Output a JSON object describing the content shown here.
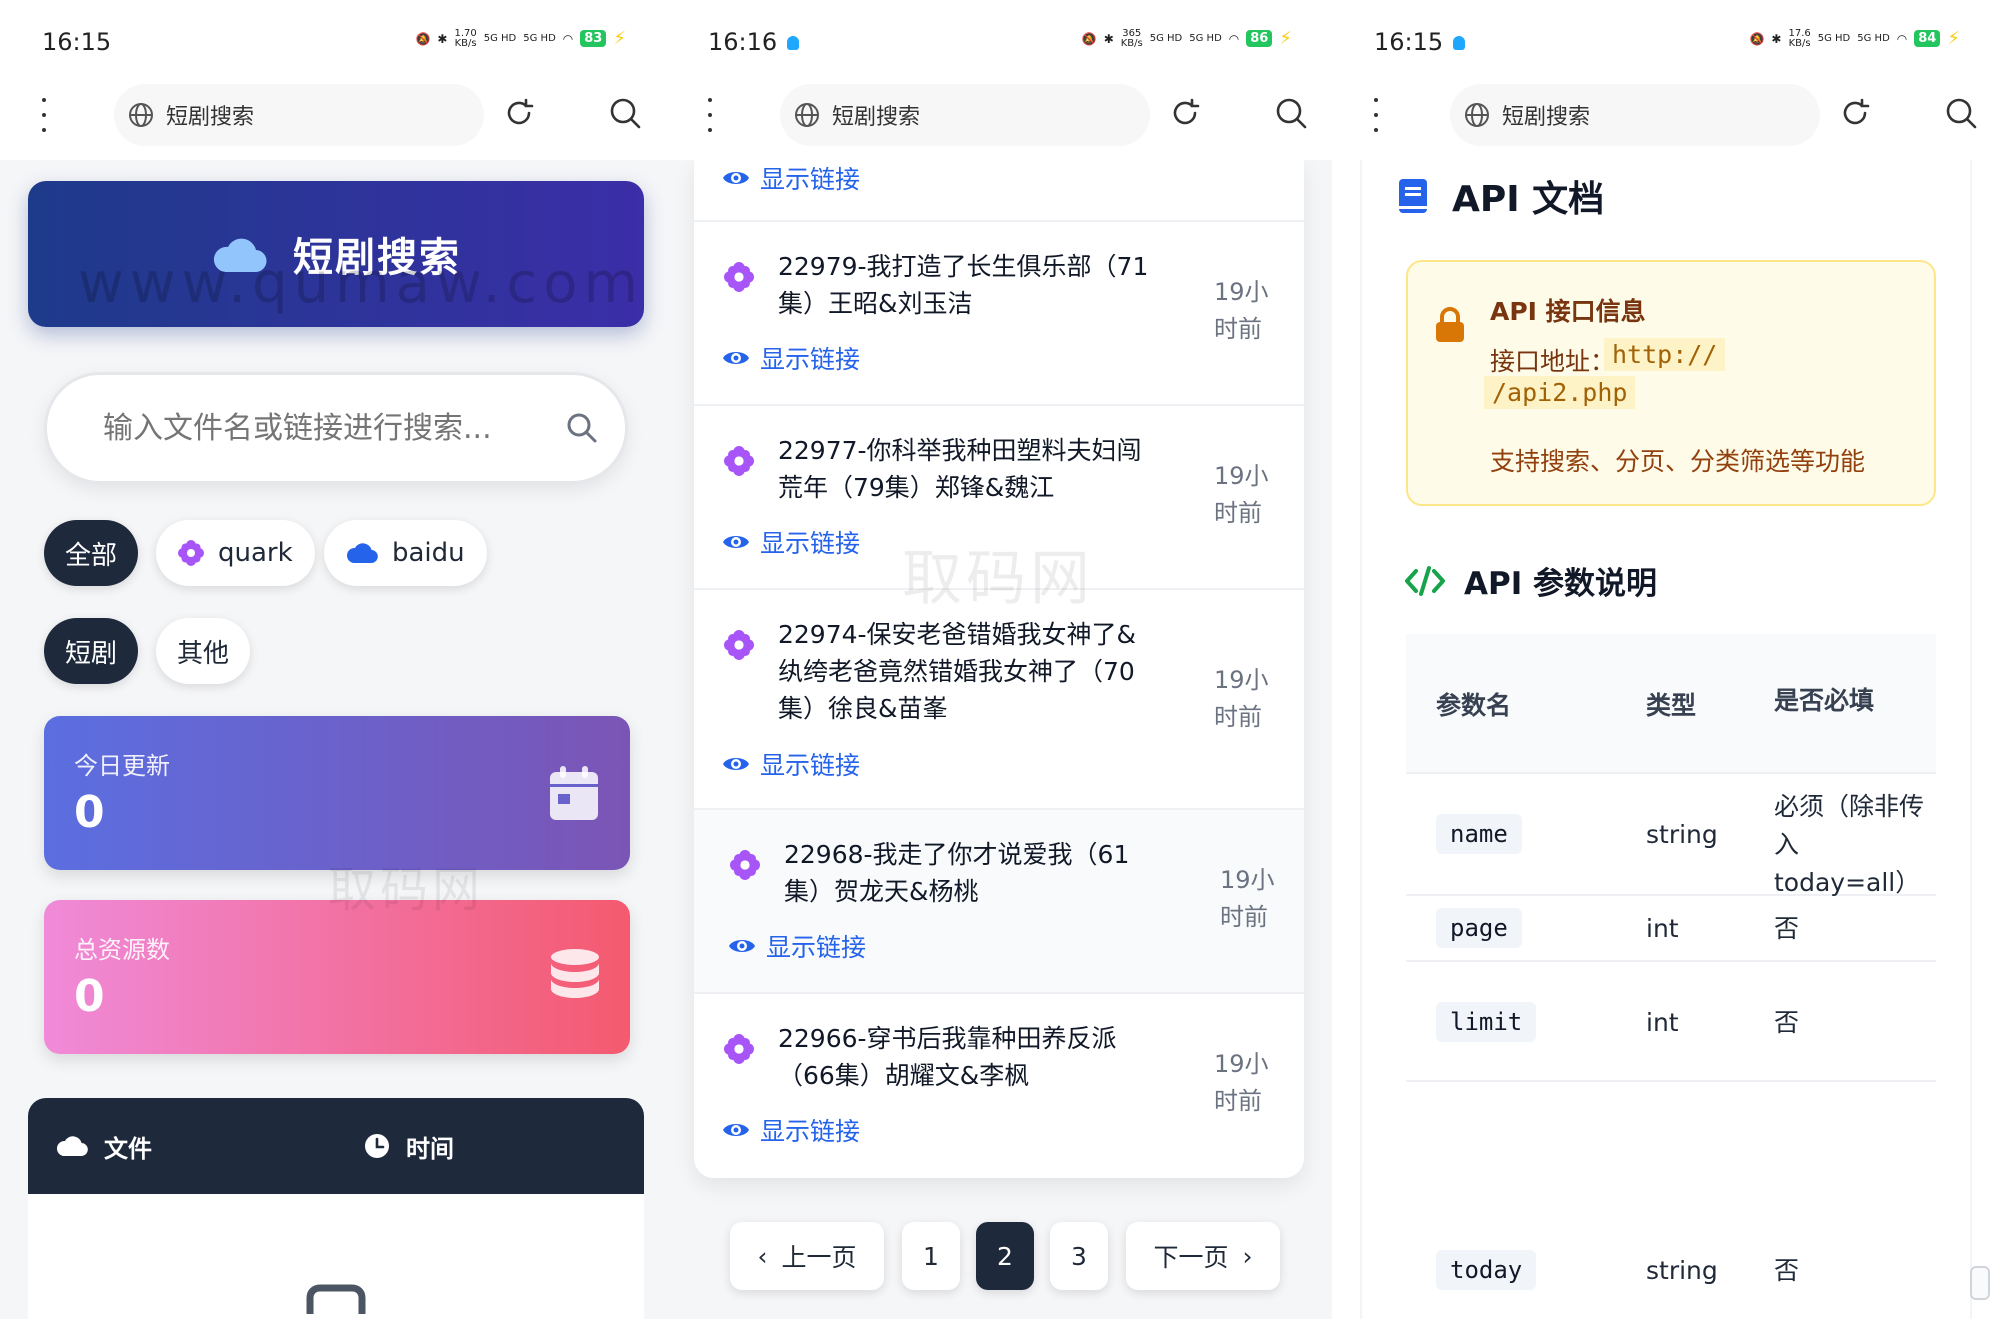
{
  "screens": [
    {
      "status": {
        "time": "16:15",
        "speed_value": "1.70",
        "speed_unit": "KB/s",
        "sig1": "5G HD",
        "sig2": "5G HD",
        "battery": "83"
      },
      "browser": {
        "url": "短剧搜索"
      },
      "hero": {
        "title": "短剧搜索",
        "watermark": "www.qumaw.com"
      },
      "search": {
        "placeholder": "输入文件名或链接进行搜索..."
      },
      "filters_source": [
        {
          "label": "全部",
          "active": true
        },
        {
          "label": "quark",
          "icon": "flower-icon"
        },
        {
          "label": "baidu",
          "icon": "cloud-icon"
        }
      ],
      "filters_category": [
        {
          "label": "短剧",
          "active": true
        },
        {
          "label": "其他"
        }
      ],
      "stats": [
        {
          "label": "今日更新",
          "value": "0",
          "icon": "calendar-icon"
        },
        {
          "label": "总资源数",
          "value": "0",
          "icon": "database-icon"
        }
      ],
      "table": {
        "col_file": "文件",
        "col_time": "时间"
      },
      "watermark": "取码网"
    },
    {
      "status": {
        "time": "16:16",
        "speed_value": "365",
        "speed_unit": "KB/s",
        "sig1": "5G HD",
        "sig2": "5G HD",
        "battery": "86"
      },
      "browser": {
        "url": "短剧搜索"
      },
      "link_label": "显示链接",
      "items": [
        {
          "title": "22979-我打造了长生俱乐部（71集）王昭&刘玉洁",
          "time": "19小时前"
        },
        {
          "title": "22977-你科举我种田塑料夫妇闯荒年（79集）郑锋&魏江",
          "time": "19小时前"
        },
        {
          "title": "22974-保安老爸错婚我女神了&纨绔老爸竟然错婚我女神了（70集）徐良&苗峯",
          "time": "19小时前"
        },
        {
          "title": "22968-我走了你才说爱我（61集）贺龙天&杨桃",
          "time": "19小时前"
        },
        {
          "title": "22966-穿书后我靠种田养反派（66集）胡耀文&李枫",
          "time": "19小时前"
        }
      ],
      "pagination": {
        "prev": "上一页",
        "pages": [
          "1",
          "2",
          "3"
        ],
        "current": "2",
        "next": "下一页"
      },
      "watermark": "取码网"
    },
    {
      "status": {
        "time": "16:15",
        "speed_value": "17.6",
        "speed_unit": "KB/s",
        "sig1": "5G HD",
        "sig2": "5G HD",
        "battery": "84"
      },
      "browser": {
        "url": "短剧搜索"
      },
      "api_title": "API 文档",
      "info": {
        "title": "API 接口信息",
        "url_label": "接口地址：",
        "url_part1": "http://",
        "url_part2": "/api2.php",
        "desc": "支持搜索、分页、分类筛选等功能"
      },
      "params_title": "API 参数说明",
      "params": {
        "headers": [
          "参数名",
          "类型",
          "是否必填"
        ],
        "rows": [
          {
            "name": "name",
            "type": "string",
            "required": "必须（除非传入today=all）"
          },
          {
            "name": "page",
            "type": "int",
            "required": "否"
          },
          {
            "name": "limit",
            "type": "int",
            "required": "否"
          },
          {
            "name": "today",
            "type": "string",
            "required": "否"
          }
        ]
      }
    }
  ],
  "colors": {
    "accent": "#2563eb",
    "dark": "#1e293b",
    "hero_start": "#1e3a8a",
    "hero_end": "#3b2ea8",
    "stat1_start": "#5b6ee0",
    "stat1_end": "#7b55b5",
    "stat2_start": "#f08ad9",
    "stat2_end": "#f45a6f"
  }
}
